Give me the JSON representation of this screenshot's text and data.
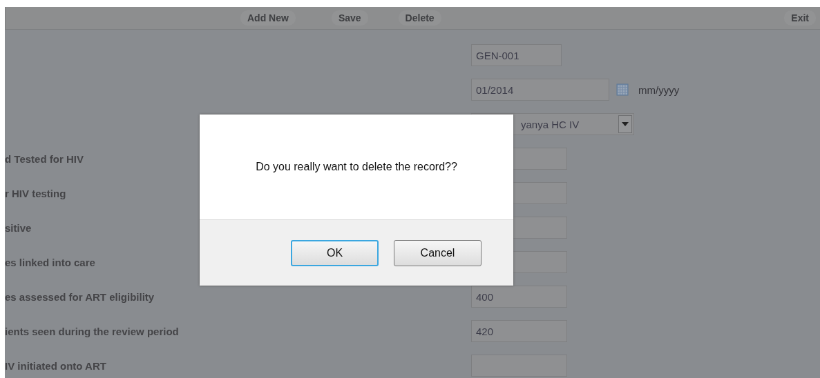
{
  "toolbar": {
    "buttons": [
      "Add New",
      "Save",
      "Delete"
    ],
    "exit": "Exit"
  },
  "form": {
    "header_fields": [
      {
        "kind": "text",
        "value": "GEN-001"
      },
      {
        "kind": "date",
        "value": "01/2014",
        "hint": "mm/yyyy"
      },
      {
        "kind": "select",
        "value": "yanya HC IV"
      }
    ],
    "rows": [
      {
        "label": "d Tested for HIV"
      },
      {
        "label": "r HIV testing"
      },
      {
        "label": "sitive"
      },
      {
        "label": "es linked into care"
      },
      {
        "label": "es assessed for ART eligibility",
        "value": "400"
      },
      {
        "label": "ients seen during the review period",
        "value": "420"
      },
      {
        "label": "IV initiated onto ART"
      }
    ]
  },
  "dialog": {
    "message": "Do you really want to delete the record??",
    "buttons": [
      {
        "label": "OK",
        "focused": true
      },
      {
        "label": "Cancel",
        "focused": false
      }
    ]
  }
}
